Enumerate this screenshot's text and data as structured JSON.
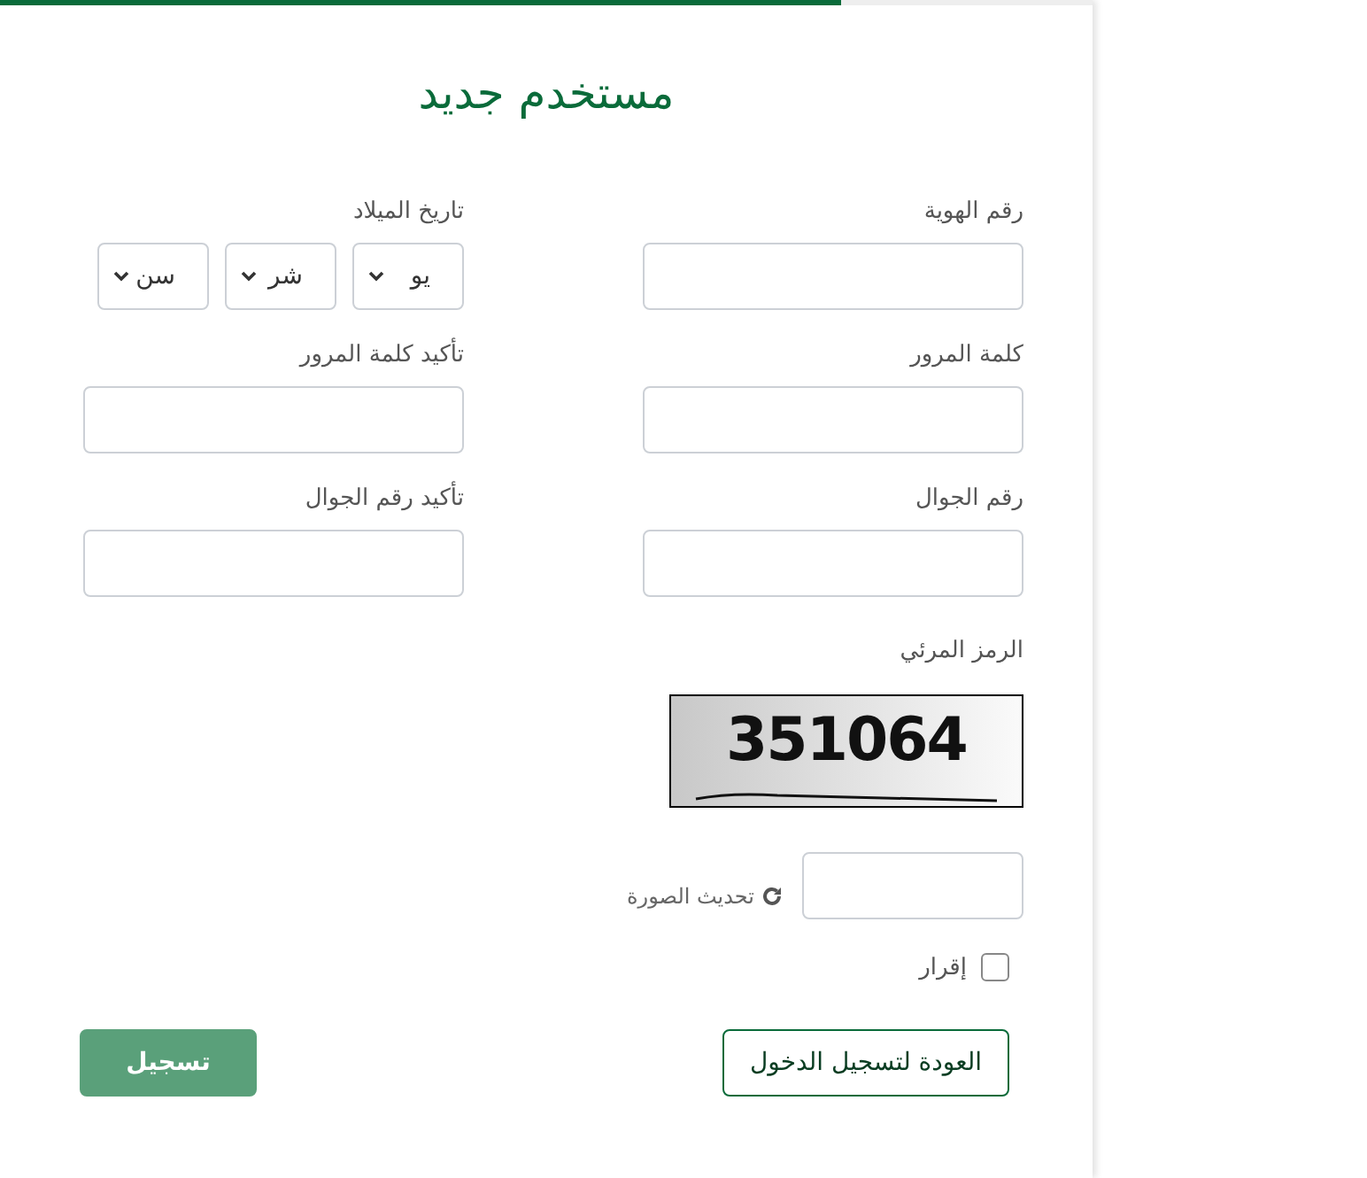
{
  "progress": {
    "level": 0.77
  },
  "title": "مستخدم جديد",
  "fields": [
    {
      "kind": "text",
      "label": "رقم الهوية"
    },
    {
      "kind": "date",
      "label": "تاريخ الميلاد",
      "selects": [
        {
          "value": "يو"
        },
        {
          "value": "شر"
        },
        {
          "value": "سن"
        }
      ]
    },
    {
      "kind": "text",
      "label": "كلمة المرور"
    },
    {
      "kind": "text",
      "label": "تأكيد كلمة المرور"
    },
    {
      "kind": "text",
      "label": "رقم الجوال"
    },
    {
      "kind": "text",
      "label": "تأكيد رقم الجوال"
    }
  ],
  "captcha": {
    "label": "الرمز المرئي",
    "code": "351064",
    "refresh": "تحديث الصورة"
  },
  "agreement": {
    "label": "إقرار",
    "checked": false
  },
  "buttons": [
    {
      "kind": "outline",
      "label": "العودة لتسجيل الدخول"
    },
    {
      "kind": "primary",
      "label": "تسجيل"
    }
  ]
}
